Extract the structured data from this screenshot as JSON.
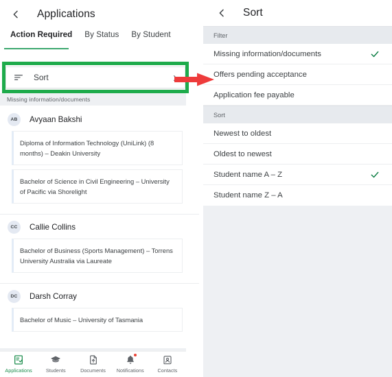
{
  "left": {
    "header": {
      "back_icon": "back-chevron-icon",
      "title": "Applications"
    },
    "tabs": [
      {
        "label": "Action Required",
        "active": true
      },
      {
        "label": "By Status",
        "active": false
      },
      {
        "label": "By Student",
        "active": false
      }
    ],
    "sort_row": {
      "icon": "sort-icon",
      "label": "Sort",
      "chevron": "chevron-right-icon"
    },
    "section_header": "Missing information/documents",
    "students": [
      {
        "initials": "AB",
        "name": "Avyaan Bakshi",
        "applications": [
          "Diploma of Information Technology (UniLink) (8 months) – Deakin University",
          "Bachelor of Science in Civil Engineering – University of Pacific via Shorelight"
        ]
      },
      {
        "initials": "CC",
        "name": "Callie Collins",
        "applications": [
          "Bachelor of Business (Sports Management) – Torrens University Australia via Laureate"
        ]
      },
      {
        "initials": "DC",
        "name": "Darsh Corray",
        "applications": [
          "Bachelor of Music – University of Tasmania"
        ]
      }
    ],
    "bottom_nav": [
      {
        "label": "Applications",
        "icon": "applications-icon",
        "active": true,
        "badge": false
      },
      {
        "label": "Students",
        "icon": "students-graduation-cap-icon",
        "active": false,
        "badge": false
      },
      {
        "label": "Documents",
        "icon": "documents-icon",
        "active": false,
        "badge": false
      },
      {
        "label": "Notifications",
        "icon": "notifications-bell-icon",
        "active": false,
        "badge": true
      },
      {
        "label": "Contacts",
        "icon": "contacts-icon",
        "active": false,
        "badge": false
      }
    ]
  },
  "right": {
    "header": {
      "back_icon": "back-chevron-icon",
      "title": "Sort"
    },
    "filter_group_label": "Filter",
    "filter_options": [
      {
        "label": "Missing information/documents",
        "selected": true
      },
      {
        "label": "Offers pending acceptance",
        "selected": false
      },
      {
        "label": "Application fee payable",
        "selected": false
      }
    ],
    "sort_group_label": "Sort",
    "sort_options": [
      {
        "label": "Newest to oldest",
        "selected": false
      },
      {
        "label": "Oldest to newest",
        "selected": false
      },
      {
        "label": "Student name A – Z",
        "selected": true
      },
      {
        "label": "Student name Z – A",
        "selected": false
      }
    ]
  },
  "annotations": {
    "highlight_box": {
      "name": "sort-row-highlight",
      "color": "#1eab4b"
    },
    "arrow": {
      "name": "pointer-arrow",
      "color": "#ee3b3b"
    }
  },
  "colors": {
    "accent_green": "#1e8e4e",
    "tab_underline": "#3aa76d",
    "check_green": "#0b7d43",
    "badge_red": "#ea4335",
    "band_gray": "#eef0f3"
  }
}
